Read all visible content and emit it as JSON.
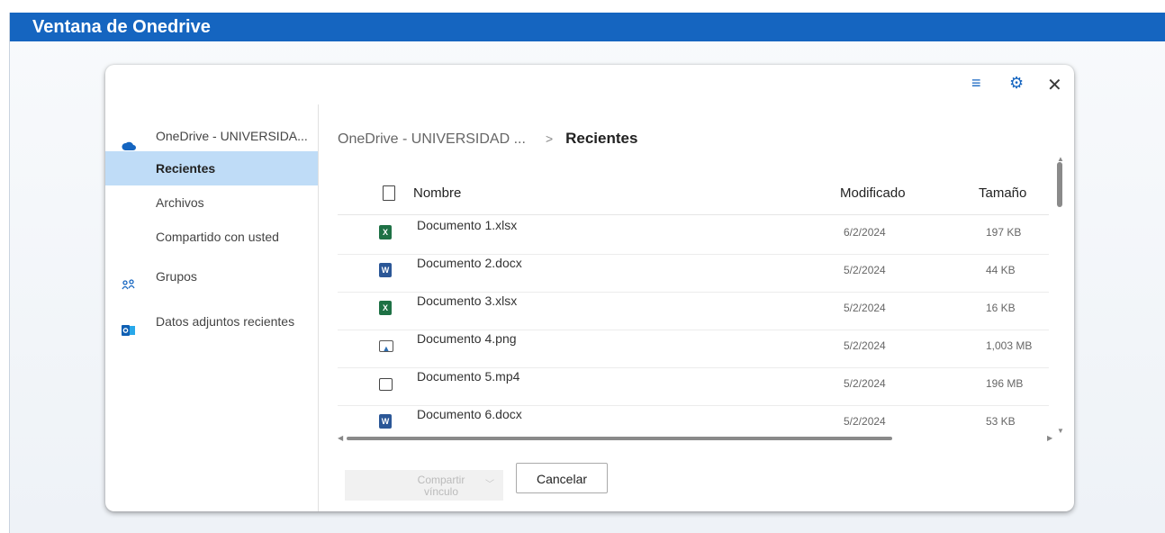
{
  "window": {
    "title": "Ventana de Onedrive"
  },
  "toolbar": {
    "sort_icon": "sort-lines-icon",
    "settings_icon": "gear-icon",
    "close_icon": "close-icon"
  },
  "sidebar": {
    "items": [
      {
        "label": "OneDrive - UNIVERSIDA...",
        "icon": "onedrive-cloud-icon"
      },
      {
        "label": "Recientes",
        "active": true
      },
      {
        "label": "Archivos"
      },
      {
        "label": "Compartido con usted"
      },
      {
        "label": "Grupos",
        "icon": "groups-icon"
      },
      {
        "label": "Datos adjuntos recientes",
        "icon": "outlook-icon"
      }
    ]
  },
  "breadcrumb": {
    "root": "OneDrive - UNIVERSIDAD ...",
    "separator": ">",
    "current": "Recientes"
  },
  "table": {
    "headers": {
      "name": "Nombre",
      "modified": "Modificado",
      "size": "Tamaño"
    },
    "rows": [
      {
        "icon": "excel-icon",
        "name": "Documento 1.xlsx",
        "modified": "6/2/2024",
        "size": "197 KB"
      },
      {
        "icon": "word-icon",
        "name": "Documento 2.docx",
        "modified": "5/2/2024",
        "size": "44 KB"
      },
      {
        "icon": "excel-icon",
        "name": "Documento 3.xlsx",
        "modified": "5/2/2024",
        "size": "16 KB"
      },
      {
        "icon": "image-icon",
        "name": "Documento 4.png",
        "modified": "5/2/2024",
        "size": "1,003 MB"
      },
      {
        "icon": "video-icon",
        "name": "Documento 5.mp4",
        "modified": "5/2/2024",
        "size": "196 MB"
      },
      {
        "icon": "word-icon",
        "name": "Documento 6.docx",
        "modified": "5/2/2024",
        "size": "53 KB"
      }
    ]
  },
  "actions": {
    "share_label_line1": "Compartir",
    "share_label_line2": "vínculo",
    "cancel_label": "Cancelar"
  },
  "colors": {
    "title_bar": "#1565c0",
    "selected": "#bfdcf7"
  }
}
